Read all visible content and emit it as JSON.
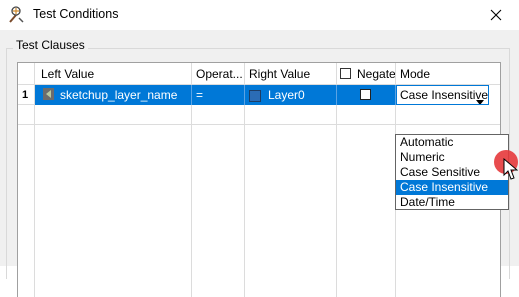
{
  "window": {
    "title": "Test Conditions"
  },
  "group": {
    "label": "Test Clauses"
  },
  "grid": {
    "headers": {
      "left_value": "Left Value",
      "operator": "Operat...",
      "right_value": "Right Value",
      "negate": "Negate",
      "mode": "Mode"
    },
    "rows": [
      {
        "number": "1",
        "left_value": "sketchup_layer_name",
        "operator": "=",
        "right_value": "Layer0",
        "mode": "Case Insensitive"
      }
    ]
  },
  "mode_dropdown": {
    "options": [
      "Automatic",
      "Numeric",
      "Case Sensitive",
      "Case Insensitive",
      "Date/Time"
    ],
    "highlighted_index": 3
  },
  "colors": {
    "selection": "#0078d7",
    "cursor_marker": "#e5383b"
  }
}
